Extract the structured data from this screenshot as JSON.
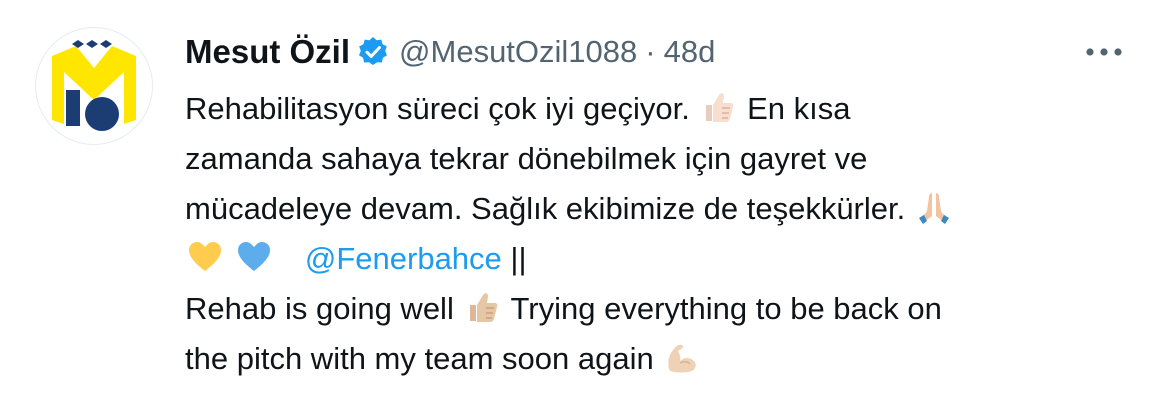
{
  "author": {
    "display_name": "Mesut Özil",
    "handle": "@MesutOzil1088",
    "separator": "·",
    "age": "48d",
    "verified": true
  },
  "tweet": {
    "lines": [
      {
        "a": "Rehabilitasyon süreci çok iyi geçiyor.",
        "emoji1": "thumbs-up-light-skin",
        "b": "En kısa"
      },
      {
        "a": "zamanda sahaya tekrar dönebilmek için gayret ve"
      },
      {
        "a": "mücadeleye devam. Sağlık ekibimize de teşekkürler.",
        "emoji1": "folded-hands"
      },
      {
        "emoji1": "yellow-heart",
        "emoji2": "blue-heart",
        "mention": "@Fenerbahce",
        "b": "||"
      },
      {
        "a": "Rehab is going well",
        "emoji1": "thumbs-up-medium-light-skin",
        "b": "Trying everything to be back on"
      },
      {
        "a": "the pitch with my team soon again",
        "emoji1": "flexed-biceps"
      }
    ]
  },
  "colors": {
    "verified_badge": "#1d9bf0",
    "mention": "#1d9bf0",
    "secondary_text": "#536471",
    "avatar_yellow": "#ffe600",
    "avatar_navy": "#1c3d73"
  }
}
